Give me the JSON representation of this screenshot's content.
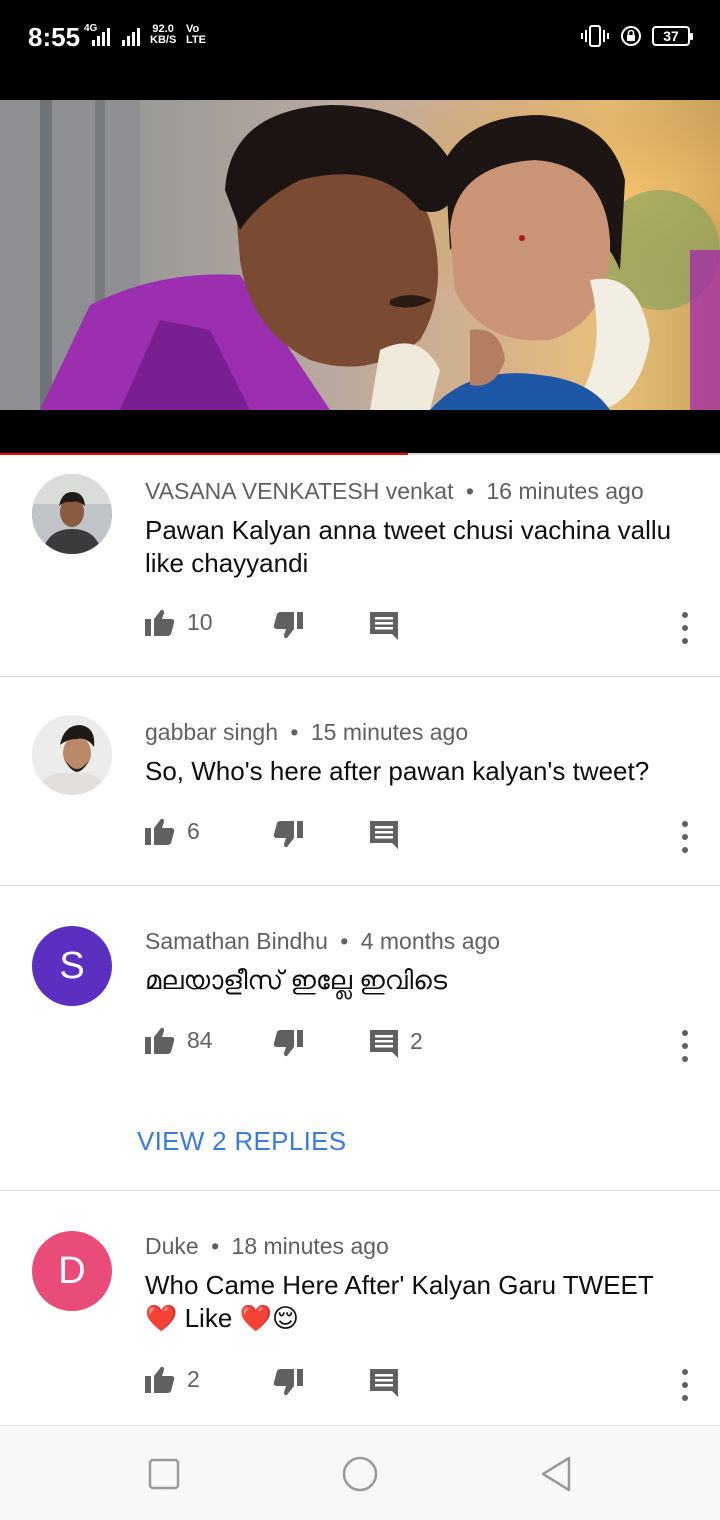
{
  "status_bar": {
    "time": "8:55",
    "network": "4G",
    "speed_value": "92.0",
    "speed_unit": "KB/S",
    "volte_top": "Vo",
    "volte_bottom": "LTE",
    "battery": "37"
  },
  "video": {
    "progress_fraction": 0.567
  },
  "comments": [
    {
      "author": "VASANA VENKATESH venkat",
      "time": "16 minutes ago",
      "text": "Pawan Kalyan anna tweet chusi vachina vallu like chayyandi",
      "likes": "10",
      "replies": ""
    },
    {
      "author": "gabbar singh",
      "time": "15 minutes ago",
      "text": "So, Who's here after pawan kalyan's tweet?",
      "likes": "6",
      "replies": ""
    },
    {
      "author": "Samathan Bindhu",
      "avatar_letter": "S",
      "avatar_color": "#5b2fbf",
      "time": "4 months ago",
      "text": "മലയാളീസ് ഇല്ലേ ഇവിടെ",
      "likes": "84",
      "replies": "2",
      "view_replies": "VIEW 2 REPLIES"
    },
    {
      "author": "Duke",
      "avatar_letter": "D",
      "avatar_color": "#ea4c7a",
      "time": "18 minutes ago",
      "text": "Who Came Here After' Kalyan Garu TWEET ❤️ Like ❤️😌",
      "likes": "2",
      "replies": ""
    }
  ],
  "separator": "•",
  "colors": {
    "link": "#3a7be0",
    "progress": "#ff0000",
    "meta_text": "#606060"
  },
  "icons": {
    "like": "thumbs-up-icon",
    "dislike": "thumbs-down-icon",
    "reply": "comment-icon",
    "more": "more-vert-icon",
    "nav": [
      "square-recents-icon",
      "circle-home-icon",
      "triangle-back-icon"
    ]
  }
}
